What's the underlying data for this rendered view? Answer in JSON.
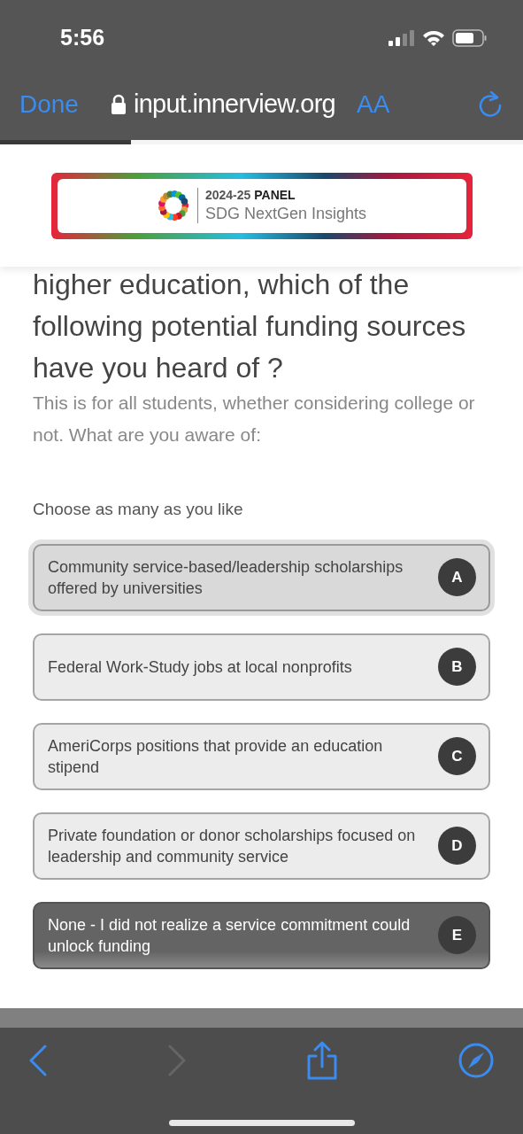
{
  "status_bar": {
    "time": "5:56"
  },
  "browser": {
    "done": "Done",
    "url": "input.innerview.org",
    "text_size": "AA",
    "progress": {
      "level": 0.25
    }
  },
  "banner": {
    "year": "2024-25",
    "panel": "PANEL",
    "name": "SDG NextGen Insights"
  },
  "question": {
    "title": "higher education, which of the following potential funding sources have you heard of ?",
    "description": "This is for all students, whether considering college or not.  What are you aware of:",
    "instruction": "Choose as many as you like"
  },
  "options": [
    {
      "text": "Community service-based/leadership scholarships offered by universities",
      "key": "A",
      "focused": true,
      "selected": false
    },
    {
      "text": "Federal Work-Study jobs at local nonprofits",
      "key": "B",
      "focused": false,
      "selected": false
    },
    {
      "text": "AmeriCorps positions that provide an education stipend",
      "key": "C",
      "focused": false,
      "selected": false
    },
    {
      "text": "Private foundation or donor scholarships focused on leadership and community service",
      "key": "D",
      "focused": false,
      "selected": false
    },
    {
      "text": "None - I did not realize a service commitment could unlock funding",
      "key": "E",
      "focused": false,
      "selected": true
    }
  ],
  "toolbar": {
    "back_disabled": false,
    "forward_disabled": true
  }
}
